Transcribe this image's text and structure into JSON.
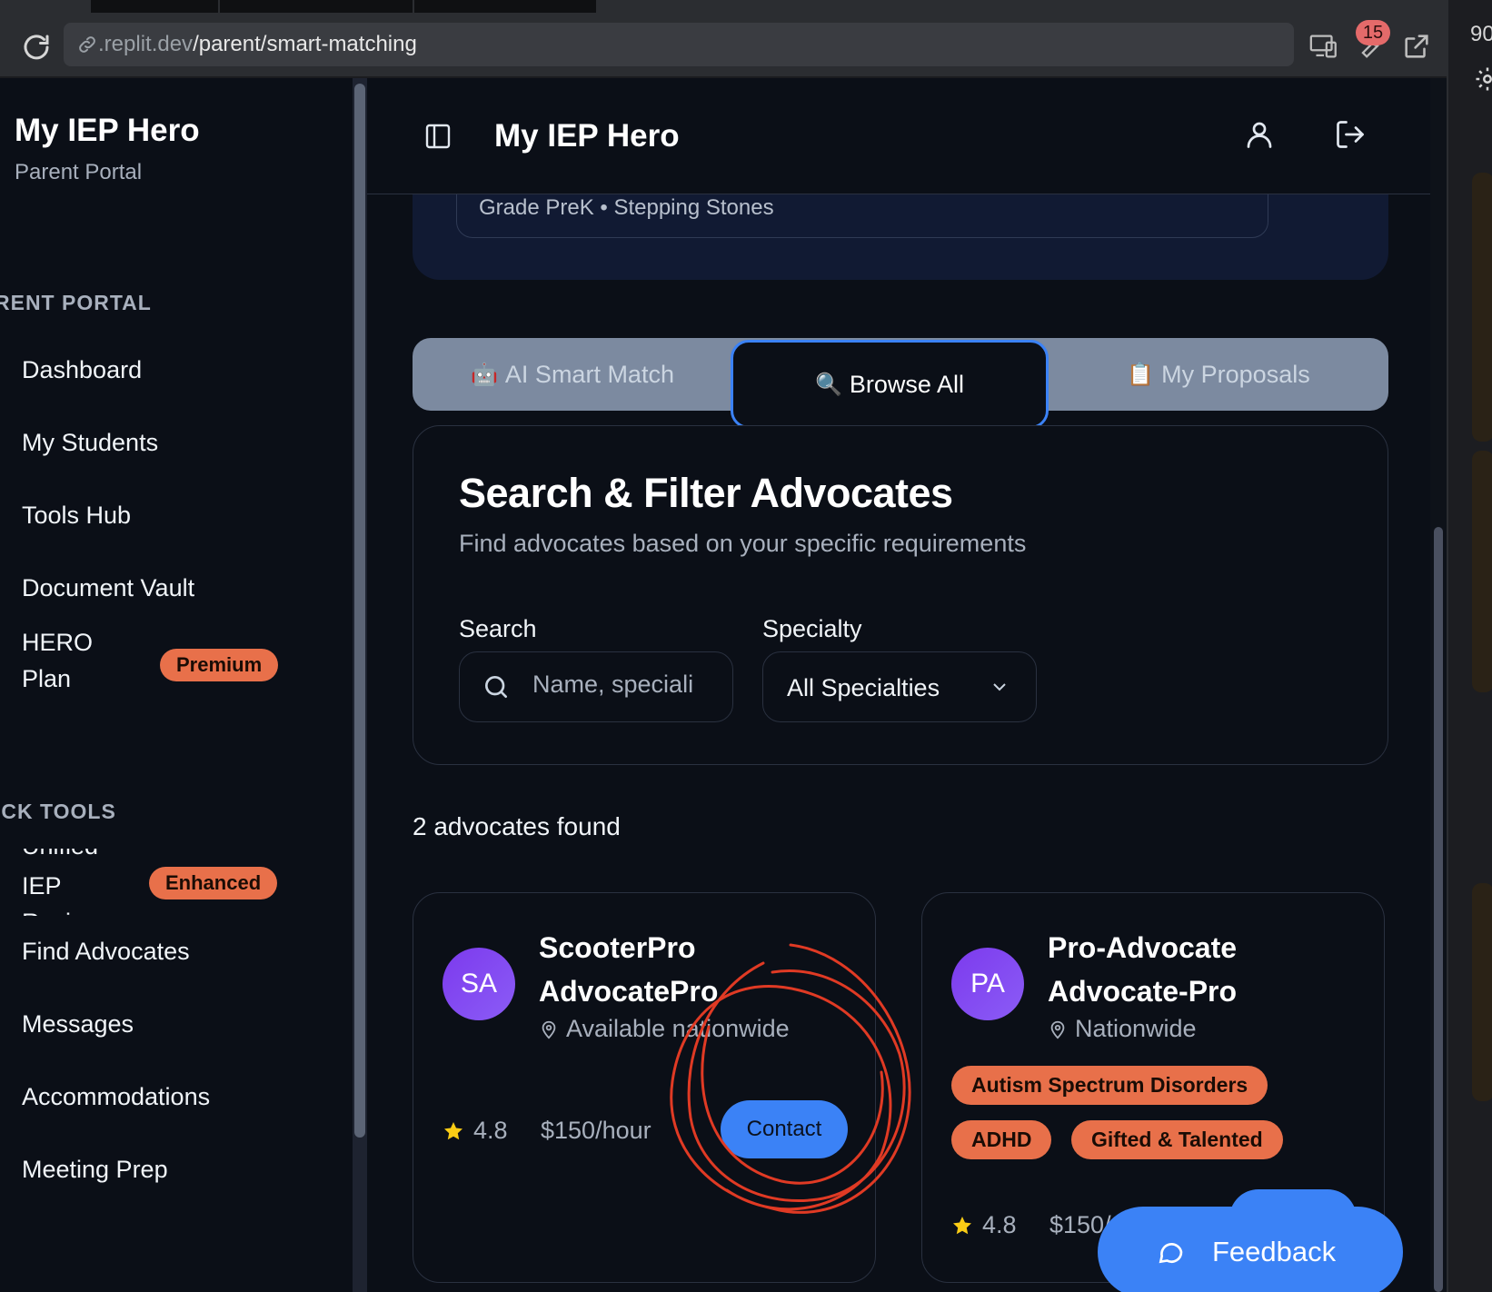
{
  "browser": {
    "url_domain": ".replit.dev",
    "url_path": "/parent/smart-matching",
    "badge_count": "15",
    "side_number": "90"
  },
  "sidebar": {
    "brand": "My IEP Hero",
    "brand_sub": "Parent Portal",
    "section_parent": "RENT PORTAL",
    "section_tools": "ICK TOOLS",
    "items": {
      "dashboard": "Dashboard",
      "students": "My Students",
      "tools_hub": "Tools Hub",
      "vault": "Document Vault",
      "hero_1": "HERO",
      "hero_2": "Plan",
      "hero_badge": "Premium",
      "iep_top": "Unified",
      "iep": "IEP",
      "iep_bottom": "Review",
      "iep_badge": "Enhanced",
      "find": "Find Advocates",
      "messages": "Messages",
      "accommodations": "Accommodations",
      "meeting": "Meeting Prep"
    }
  },
  "header": {
    "title": "My IEP Hero"
  },
  "student": {
    "meta": "Grade PreK • Stepping Stones"
  },
  "tabs": [
    {
      "emoji": "🤖",
      "label": "AI Smart Match"
    },
    {
      "emoji": "🔍",
      "label": "Browse All"
    },
    {
      "emoji": "📋",
      "label": "My Proposals"
    }
  ],
  "filters": {
    "title": "Search & Filter Advocates",
    "subtitle": "Find advocates based on your specific requirements",
    "search_label": "Search",
    "search_placeholder": "Name, speciali",
    "specialty_label": "Specialty",
    "specialty_value": "All Specialties"
  },
  "results": {
    "count_text": "2 advocates found",
    "advocates": [
      {
        "initials": "SA",
        "name_1": "ScooterPro",
        "name_2": "AdvocatePro",
        "location": "Available nationwide",
        "rating": "4.8",
        "rate": "$150/hour",
        "contact": "Contact"
      },
      {
        "initials": "PA",
        "name_1": "Pro-Advocate",
        "name_2": "Advocate-Pro",
        "location": "Nationwide",
        "tags": [
          "Autism Spectrum Disorders",
          "ADHD",
          "Gifted & Talented"
        ],
        "rating": "4.8",
        "rate": "$150/"
      }
    ]
  },
  "feedback": {
    "label": "Feedback"
  },
  "colors": {
    "accent": "#3b82f6",
    "badge": "#e8704a",
    "avatar": "#7c3aed",
    "annotation": "#e03a24"
  }
}
